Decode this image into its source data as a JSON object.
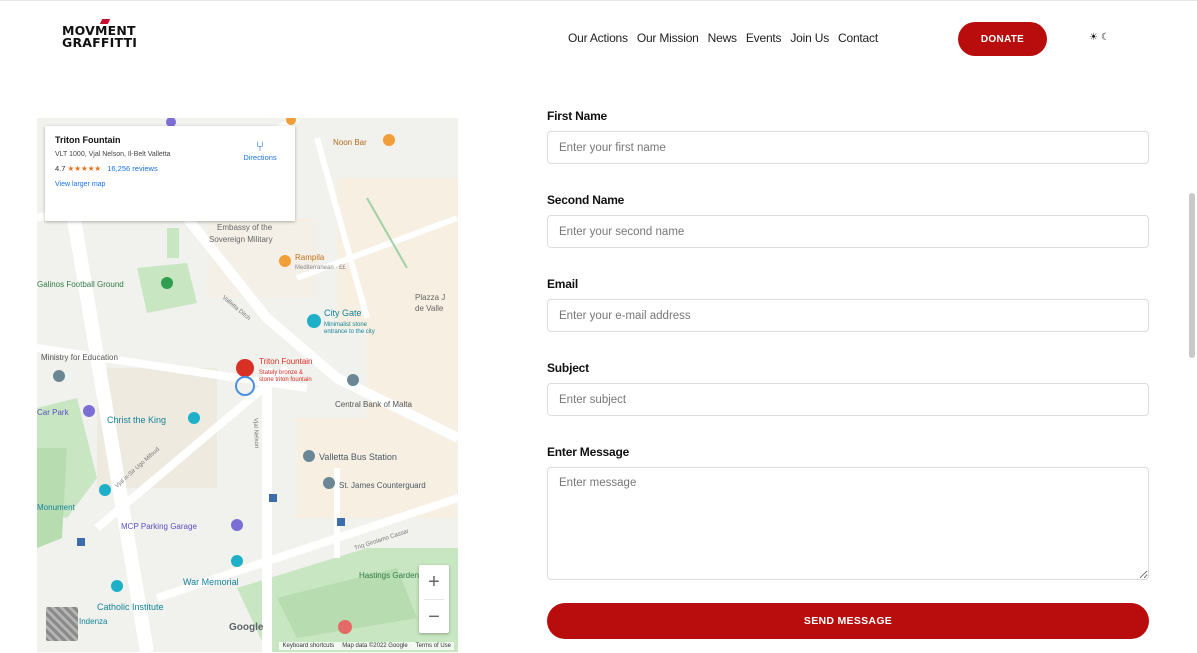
{
  "header": {
    "logo_line1": "MOVMENT",
    "logo_line2": "GRAFFITTI",
    "nav": [
      {
        "label": "Our Actions"
      },
      {
        "label": "Our Mission"
      },
      {
        "label": "News"
      },
      {
        "label": "Events"
      },
      {
        "label": "Join Us"
      },
      {
        "label": "Contact"
      }
    ],
    "donate_label": "DONATE",
    "theme_light": "☀",
    "theme_dark": "☾"
  },
  "map": {
    "place_title": "Triton Fountain",
    "address": "VLT 1000, Vjal Nelson, Il-Belt Valletta",
    "rating": "4.7",
    "stars": "★★★★★",
    "reviews": "16,256 reviews",
    "larger_map": "View larger map",
    "directions": "Directions",
    "labels": {
      "noon_bar": "Noon Bar",
      "embassy": "Embassy of the Sovereign Military",
      "rampila": "Rampila",
      "rampila_sub": "Mediterranean · ££",
      "football": "Galinos Football Ground",
      "city_gate": "City Gate",
      "city_gate_sub": "Minimalist stone entrance to the city",
      "plazza": "Plazza J de Valle",
      "ministry": "Ministry for Education",
      "triton": "Triton Fountain",
      "triton_sub": "Stately bronze & stone triton fountain",
      "central_bank": "Central Bank of Malta",
      "car_park": "Car Park",
      "christ_king": "Christ the King",
      "bus_station": "Valletta Bus Station",
      "st_james": "St. James Counterguard",
      "monument": "Monument",
      "mcp_parking": "MCP Parking Garage",
      "war_memorial": "War Memorial",
      "catholic": "Catholic Institute",
      "hastings": "Hastings Garden",
      "indenza": "Indenza",
      "vjal_nelson": "Vjal Nelson",
      "valletta_ditch": "Valletta Ditch",
      "triq_sir_ugo": "Vjal is-Sir Ugo Mifsud",
      "triq_girolamo": "Triq Girolamo Cassar",
      "google": "Google"
    },
    "zoom_in": "+",
    "zoom_out": "−",
    "attribution": [
      "Keyboard shortcuts",
      "Map data ©2022 Google",
      "Terms of Use"
    ]
  },
  "form": {
    "first_name_label": "First Name",
    "first_name_placeholder": "Enter your first name",
    "second_name_label": "Second Name",
    "second_name_placeholder": "Enter your second name",
    "email_label": "Email",
    "email_placeholder": "Enter your e-mail address",
    "subject_label": "Subject",
    "subject_placeholder": "Enter subject",
    "message_label": "Enter Message",
    "message_placeholder": "Enter message",
    "send_label": "SEND MESSAGE"
  },
  "colors": {
    "accent": "#b90c0c",
    "map_green": "#c7e6c1",
    "map_water": "#a9d7f2"
  }
}
